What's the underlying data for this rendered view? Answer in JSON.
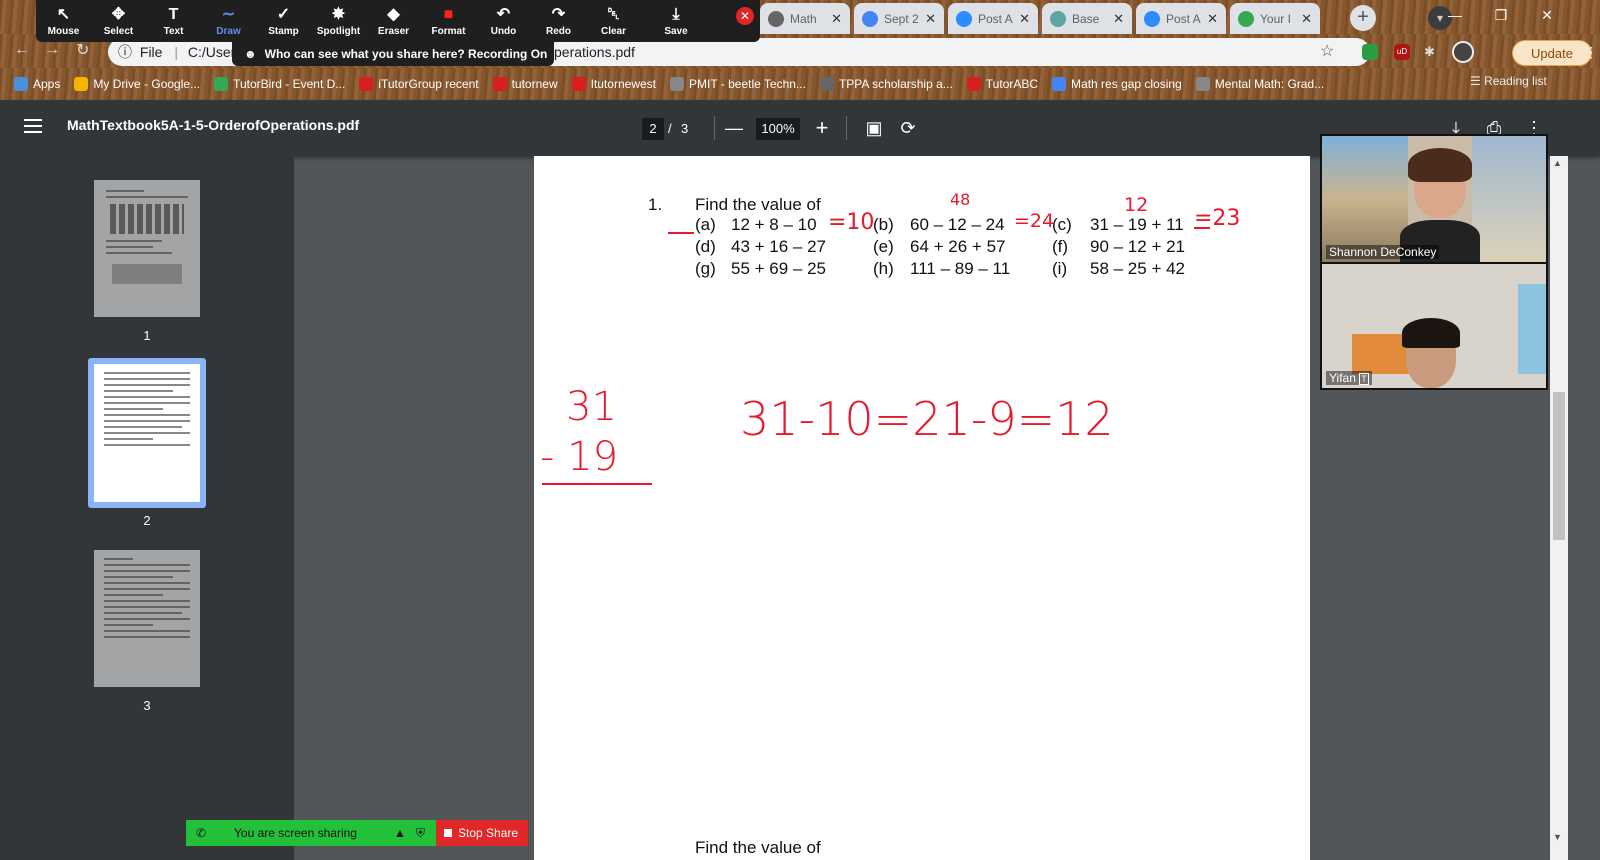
{
  "annotation_toolbar": {
    "tools": [
      {
        "label": "Mouse",
        "icon": "cursor-icon"
      },
      {
        "label": "Select",
        "icon": "move-icon"
      },
      {
        "label": "Text",
        "icon": "text-icon"
      },
      {
        "label": "Draw",
        "icon": "draw-icon",
        "active": true
      },
      {
        "label": "Stamp",
        "icon": "check-icon"
      },
      {
        "label": "Spotlight",
        "icon": "wand-icon"
      },
      {
        "label": "Eraser",
        "icon": "eraser-icon"
      },
      {
        "label": "Format",
        "icon": "format-icon"
      },
      {
        "label": "Undo",
        "icon": "undo-icon"
      },
      {
        "label": "Redo",
        "icon": "redo-icon"
      },
      {
        "label": "Clear",
        "icon": "trash-icon"
      },
      {
        "label": "Save",
        "icon": "save-icon"
      }
    ],
    "recording_banner": "Who can see what you share here? Recording On"
  },
  "browser": {
    "tabs": [
      {
        "label": "Math",
        "icon": "globe-icon"
      },
      {
        "label": "Sept 2",
        "icon": "docs-icon"
      },
      {
        "label": "Post A",
        "icon": "zoom-icon"
      },
      {
        "label": "Base",
        "icon": "base-icon"
      },
      {
        "label": "Post A",
        "icon": "zoom-icon"
      },
      {
        "label": "Your I",
        "icon": "maps-icon"
      }
    ],
    "address": {
      "scheme": "File",
      "path_start": "C:/Users",
      "path_end": "perations.pdf"
    },
    "update_label": "Update",
    "bookmarks": [
      "Apps",
      "My Drive - Google...",
      "TutorBird - Event D...",
      "iTutorGroup recent",
      "tutornew",
      "Itutornewest",
      "PMIT - beetle Techn...",
      "TPPA scholarship a...",
      "TutorABC",
      "Math res gap closing",
      "Mental Math: Grad..."
    ],
    "reading_list": "Reading list",
    "colors": {
      "accent": "#8ab4f8",
      "annotation_red": "#e8182d"
    }
  },
  "pdf": {
    "title": "MathTextbook5A-1-5-OrderofOperations.pdf",
    "current_page": "2",
    "page_sep": "/",
    "total_pages": "3",
    "zoom": "100%",
    "thumb_numbers": [
      "1",
      "2",
      "3"
    ]
  },
  "page_content": {
    "item_num": "1.",
    "heading": "Find the value of",
    "problems": [
      {
        "label": "(a)",
        "expr": "12 + 8 – 10"
      },
      {
        "label": "(b)",
        "expr": "60 – 12 – 24"
      },
      {
        "label": "(c)",
        "expr": "31 – 19 + 11"
      },
      {
        "label": "(d)",
        "expr": "43 + 16 – 27"
      },
      {
        "label": "(e)",
        "expr": "64 + 26 + 57"
      },
      {
        "label": "(f)",
        "expr": "90 – 12 + 21"
      },
      {
        "label": "(g)",
        "expr": "55 + 69 – 25"
      },
      {
        "label": "(h)",
        "expr": "111 – 89 – 11"
      },
      {
        "label": "(i)",
        "expr": "58 – 25 + 42"
      }
    ],
    "bottom_heading": "Find the value of",
    "handwriting": {
      "a_answer": "=10",
      "b_top": "48",
      "b_answer": "=24",
      "c_top": "12",
      "c_answer": "=23",
      "work_top": "31",
      "work_bottom": "- 19",
      "work_chain": "31-10=21-9=12"
    }
  },
  "video": {
    "participant1": "Shannon DeConkey",
    "participant2": "Yifan"
  },
  "sharing": {
    "status": "You are screen sharing",
    "stop_label": "Stop Share"
  }
}
